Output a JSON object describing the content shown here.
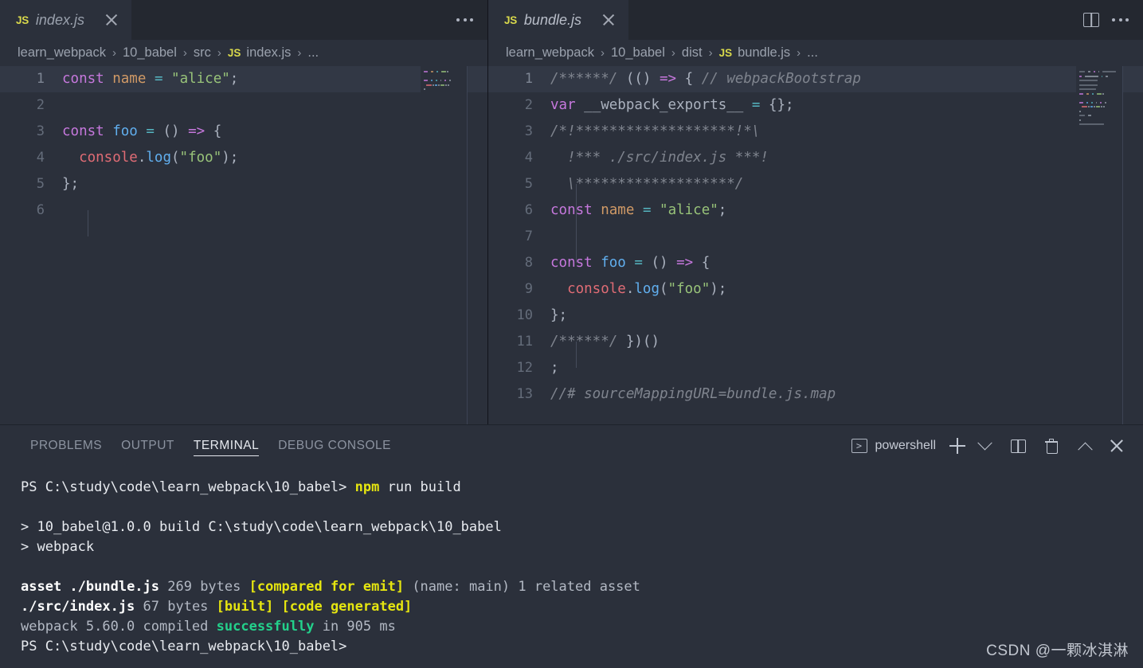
{
  "editors": [
    {
      "tab": {
        "icon": "js-file-icon",
        "label": "index.js",
        "close": "×"
      },
      "breadcrumb": [
        "learn_webpack",
        "10_babel",
        "src",
        "index.js",
        "..."
      ],
      "breadcrumb_file_icon": "JS",
      "actions": [
        "more-actions-ellipsis"
      ],
      "lines": [
        {
          "n": "1",
          "highlight": true,
          "tokens": [
            {
              "t": "const",
              "c": "kw"
            },
            {
              "t": " ",
              "c": "plain"
            },
            {
              "t": "name",
              "c": "var"
            },
            {
              "t": " ",
              "c": "plain"
            },
            {
              "t": "=",
              "c": "op"
            },
            {
              "t": " ",
              "c": "plain"
            },
            {
              "t": "\"alice\"",
              "c": "str"
            },
            {
              "t": ";",
              "c": "punc"
            }
          ]
        },
        {
          "n": "2",
          "highlight": false,
          "tokens": []
        },
        {
          "n": "3",
          "highlight": false,
          "tokens": [
            {
              "t": "const",
              "c": "kw"
            },
            {
              "t": " ",
              "c": "plain"
            },
            {
              "t": "foo",
              "c": "fn"
            },
            {
              "t": " ",
              "c": "plain"
            },
            {
              "t": "=",
              "c": "op"
            },
            {
              "t": " ",
              "c": "plain"
            },
            {
              "t": "()",
              "c": "paren"
            },
            {
              "t": " ",
              "c": "plain"
            },
            {
              "t": "=>",
              "c": "arrow"
            },
            {
              "t": " ",
              "c": "plain"
            },
            {
              "t": "{",
              "c": "punc"
            }
          ]
        },
        {
          "n": "4",
          "highlight": false,
          "tokens": [
            {
              "t": "  ",
              "c": "plain"
            },
            {
              "t": "console",
              "c": "ident"
            },
            {
              "t": ".",
              "c": "punc"
            },
            {
              "t": "log",
              "c": "fn"
            },
            {
              "t": "(",
              "c": "punc"
            },
            {
              "t": "\"foo\"",
              "c": "str"
            },
            {
              "t": ")",
              "c": "punc"
            },
            {
              "t": ";",
              "c": "punc"
            }
          ]
        },
        {
          "n": "5",
          "highlight": false,
          "tokens": [
            {
              "t": "};",
              "c": "punc"
            }
          ]
        },
        {
          "n": "6",
          "highlight": false,
          "tokens": []
        }
      ]
    },
    {
      "tab": {
        "icon": "js-file-icon",
        "label": "bundle.js",
        "close": "×"
      },
      "breadcrumb": [
        "learn_webpack",
        "10_babel",
        "dist",
        "bundle.js",
        "..."
      ],
      "breadcrumb_file_icon": "JS",
      "actions": [
        "split-editor-icon",
        "more-actions-ellipsis"
      ],
      "lines": [
        {
          "n": "1",
          "highlight": true,
          "tokens": [
            {
              "t": "/******/",
              "c": "comment"
            },
            {
              "t": " ",
              "c": "plain"
            },
            {
              "t": "(()",
              "c": "paren"
            },
            {
              "t": " ",
              "c": "plain"
            },
            {
              "t": "=>",
              "c": "arrow"
            },
            {
              "t": " ",
              "c": "plain"
            },
            {
              "t": "{",
              "c": "punc"
            },
            {
              "t": " ",
              "c": "plain"
            },
            {
              "t": "// webpackBootstrap",
              "c": "comment"
            }
          ]
        },
        {
          "n": "2",
          "highlight": false,
          "tokens": [
            {
              "t": "var",
              "c": "kw"
            },
            {
              "t": " ",
              "c": "plain"
            },
            {
              "t": "__webpack_exports__",
              "c": "plain"
            },
            {
              "t": " ",
              "c": "plain"
            },
            {
              "t": "=",
              "c": "op"
            },
            {
              "t": " ",
              "c": "plain"
            },
            {
              "t": "{};",
              "c": "punc"
            }
          ]
        },
        {
          "n": "3",
          "highlight": false,
          "tokens": [
            {
              "t": "/*!*******************!*\\",
              "c": "comment"
            }
          ]
        },
        {
          "n": "4",
          "highlight": false,
          "tokens": [
            {
              "t": "  !*** ./src/index.js ***!",
              "c": "comment"
            }
          ]
        },
        {
          "n": "5",
          "highlight": false,
          "tokens": [
            {
              "t": "  \\*******************/",
              "c": "comment"
            }
          ]
        },
        {
          "n": "6",
          "highlight": false,
          "tokens": [
            {
              "t": "const",
              "c": "kw"
            },
            {
              "t": " ",
              "c": "plain"
            },
            {
              "t": "name",
              "c": "var"
            },
            {
              "t": " ",
              "c": "plain"
            },
            {
              "t": "=",
              "c": "op"
            },
            {
              "t": " ",
              "c": "plain"
            },
            {
              "t": "\"alice\"",
              "c": "str"
            },
            {
              "t": ";",
              "c": "punc"
            }
          ]
        },
        {
          "n": "7",
          "highlight": false,
          "tokens": []
        },
        {
          "n": "8",
          "highlight": false,
          "tokens": [
            {
              "t": "const",
              "c": "kw"
            },
            {
              "t": " ",
              "c": "plain"
            },
            {
              "t": "foo",
              "c": "fn"
            },
            {
              "t": " ",
              "c": "plain"
            },
            {
              "t": "=",
              "c": "op"
            },
            {
              "t": " ",
              "c": "plain"
            },
            {
              "t": "()",
              "c": "paren"
            },
            {
              "t": " ",
              "c": "plain"
            },
            {
              "t": "=>",
              "c": "arrow"
            },
            {
              "t": " ",
              "c": "plain"
            },
            {
              "t": "{",
              "c": "punc"
            }
          ]
        },
        {
          "n": "9",
          "highlight": false,
          "tokens": [
            {
              "t": "  ",
              "c": "plain"
            },
            {
              "t": "console",
              "c": "ident"
            },
            {
              "t": ".",
              "c": "punc"
            },
            {
              "t": "log",
              "c": "fn"
            },
            {
              "t": "(",
              "c": "punc"
            },
            {
              "t": "\"foo\"",
              "c": "str"
            },
            {
              "t": ")",
              "c": "punc"
            },
            {
              "t": ";",
              "c": "punc"
            }
          ]
        },
        {
          "n": "10",
          "highlight": false,
          "tokens": [
            {
              "t": "};",
              "c": "punc"
            }
          ]
        },
        {
          "n": "11",
          "highlight": false,
          "tokens": [
            {
              "t": "/******/",
              "c": "comment"
            },
            {
              "t": " ",
              "c": "plain"
            },
            {
              "t": "})()",
              "c": "paren"
            }
          ]
        },
        {
          "n": "12",
          "highlight": false,
          "tokens": [
            {
              "t": ";",
              "c": "punc"
            }
          ]
        },
        {
          "n": "13",
          "highlight": false,
          "tokens": [
            {
              "t": "//# sourceMappingURL=bundle.js.map",
              "c": "comment"
            }
          ]
        }
      ]
    }
  ],
  "panel": {
    "tabs": [
      {
        "label": "PROBLEMS",
        "active": false
      },
      {
        "label": "OUTPUT",
        "active": false
      },
      {
        "label": "TERMINAL",
        "active": true
      },
      {
        "label": "DEBUG CONSOLE",
        "active": false
      }
    ],
    "shell_name": "powershell",
    "actions": [
      "new-terminal-icon",
      "terminal-dropdown-chevron",
      "split-terminal-icon",
      "kill-terminal-trash-icon",
      "maximize-panel-chevron-up-icon",
      "close-panel-icon"
    ],
    "terminal_lines": [
      {
        "segs": [
          {
            "t": "PS C:\\study\\code\\learn_webpack\\10_babel> ",
            "c": "white"
          },
          {
            "t": "npm",
            "c": "yellow"
          },
          {
            "t": " run build",
            "c": "white"
          }
        ]
      },
      {
        "segs": []
      },
      {
        "segs": [
          {
            "t": "> 10_babel@1.0.0 build C:\\study\\code\\learn_webpack\\10_babel",
            "c": "white"
          }
        ]
      },
      {
        "segs": [
          {
            "t": "> webpack",
            "c": "white"
          }
        ]
      },
      {
        "segs": []
      },
      {
        "segs": [
          {
            "t": "asset ",
            "c": "bold"
          },
          {
            "t": "./bundle.js",
            "c": "bold"
          },
          {
            "t": " 269 bytes ",
            "c": "gray"
          },
          {
            "t": "[compared for emit]",
            "c": "yellow"
          },
          {
            "t": " (name: main) 1 related asset",
            "c": "gray"
          }
        ]
      },
      {
        "segs": [
          {
            "t": "./src/index.js",
            "c": "bold"
          },
          {
            "t": " 67 bytes ",
            "c": "gray"
          },
          {
            "t": "[built] [code generated]",
            "c": "yellow"
          }
        ]
      },
      {
        "segs": [
          {
            "t": "webpack 5.60.0 compiled ",
            "c": "gray"
          },
          {
            "t": "successfully",
            "c": "green"
          },
          {
            "t": " in 905 ms",
            "c": "gray"
          }
        ]
      },
      {
        "segs": [
          {
            "t": "PS C:\\study\\code\\learn_webpack\\10_babel>",
            "c": "white"
          }
        ]
      }
    ]
  },
  "watermark": "CSDN @一颗冰淇淋",
  "colors": {
    "editor_bg": "#2b303b",
    "tabbar_bg": "#242830",
    "active_tab_bg": "#2b303b",
    "current_line_bg": "#323845",
    "keyword": "#c678dd",
    "string": "#98c379",
    "function": "#61afef",
    "variable": "#d19a66",
    "comment": "#7f848e",
    "terminal_yellow": "#e5e510",
    "terminal_green": "#23d18b",
    "js_badge": "#d8d84b"
  }
}
